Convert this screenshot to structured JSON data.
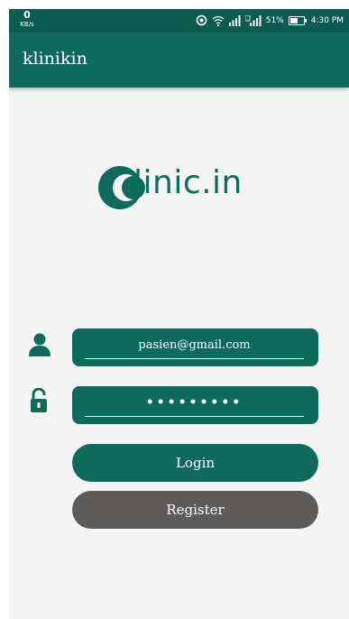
{
  "status_bar": {
    "speed_value": "0",
    "speed_unit": "KB/s",
    "battery": "51%",
    "time": "4:30 PM"
  },
  "app_bar": {
    "title": "klinikin"
  },
  "logo": {
    "text": "linic.in"
  },
  "form": {
    "email_value": "pasien@gmail.com",
    "password_value": "•••••••••"
  },
  "buttons": {
    "login_label": "Login",
    "register_label": "Register"
  },
  "colors": {
    "primary": "#0e6b5b",
    "status_bar": "#0b5c4e",
    "register_button": "#5e5b5b",
    "background": "#f4f4f4"
  }
}
